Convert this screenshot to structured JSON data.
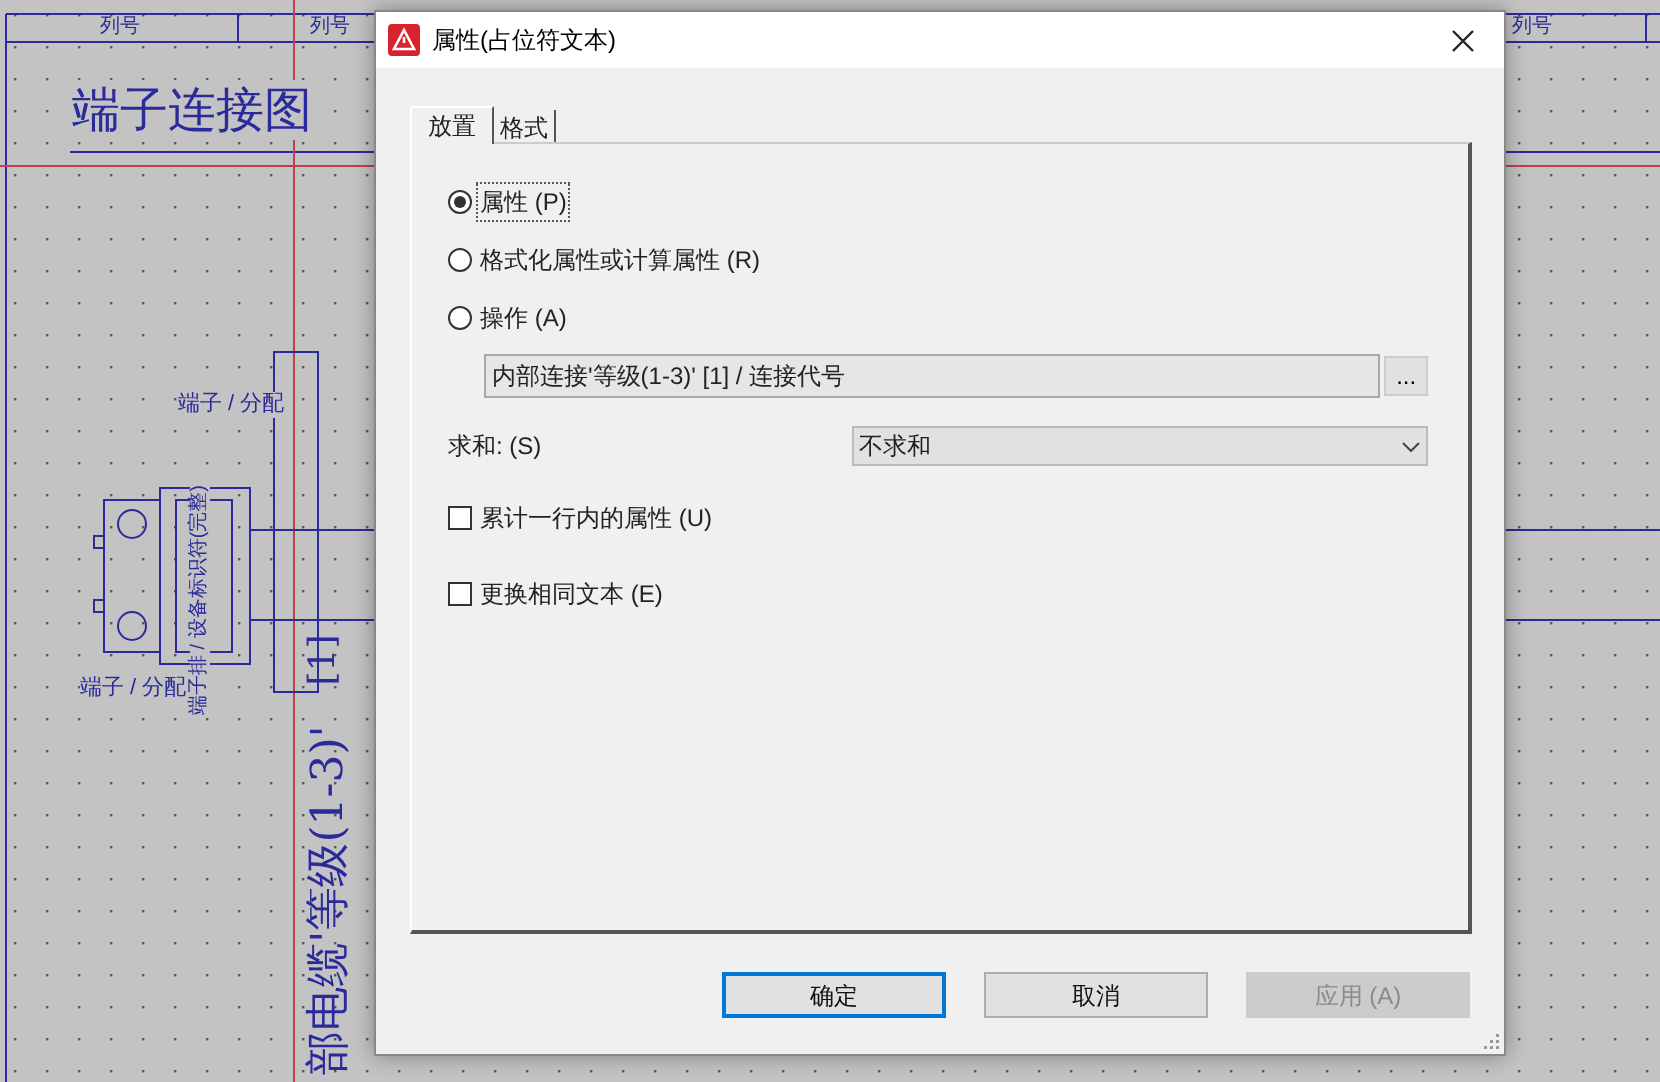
{
  "drawing": {
    "column_headers": [
      "列号",
      "列号",
      "列号"
    ],
    "title": "端子连接图",
    "labels": [
      {
        "text": "端子 / 分配",
        "kind": "horizontal"
      },
      {
        "text": "端子 / 分配",
        "kind": "horizontal"
      },
      {
        "text": "端子排 / 设备标识符(完整)",
        "kind": "vertical"
      },
      {
        "text": "[1]",
        "kind": "vertical_large"
      },
      {
        "text": "部电缆'等级(1-3)'",
        "kind": "vertical_large"
      }
    ]
  },
  "dialog": {
    "title": "属性(占位符文本)",
    "tabs": [
      {
        "label": "放置",
        "selected": true
      },
      {
        "label": "格式",
        "selected": false
      }
    ],
    "options": [
      {
        "label": "属性 (P)",
        "selected": true
      },
      {
        "label": "格式化属性或计算属性 (R)",
        "selected": false
      },
      {
        "label": "操作 (A)",
        "selected": false
      }
    ],
    "action_field": {
      "value": "内部连接'等级(1-3)' [1] / 连接代号",
      "button": "..."
    },
    "sum": {
      "label": "求和: (S)",
      "value": "不求和"
    },
    "checkboxes": [
      {
        "label": "累计一行内的属性 (U)",
        "checked": false
      },
      {
        "label": "更换相同文本 (E)",
        "checked": false
      }
    ],
    "buttons": [
      {
        "label": "确定",
        "default": true,
        "disabled": false
      },
      {
        "label": "取消",
        "default": false,
        "disabled": false
      },
      {
        "label": "应用 (A)",
        "default": false,
        "disabled": true
      }
    ]
  }
}
